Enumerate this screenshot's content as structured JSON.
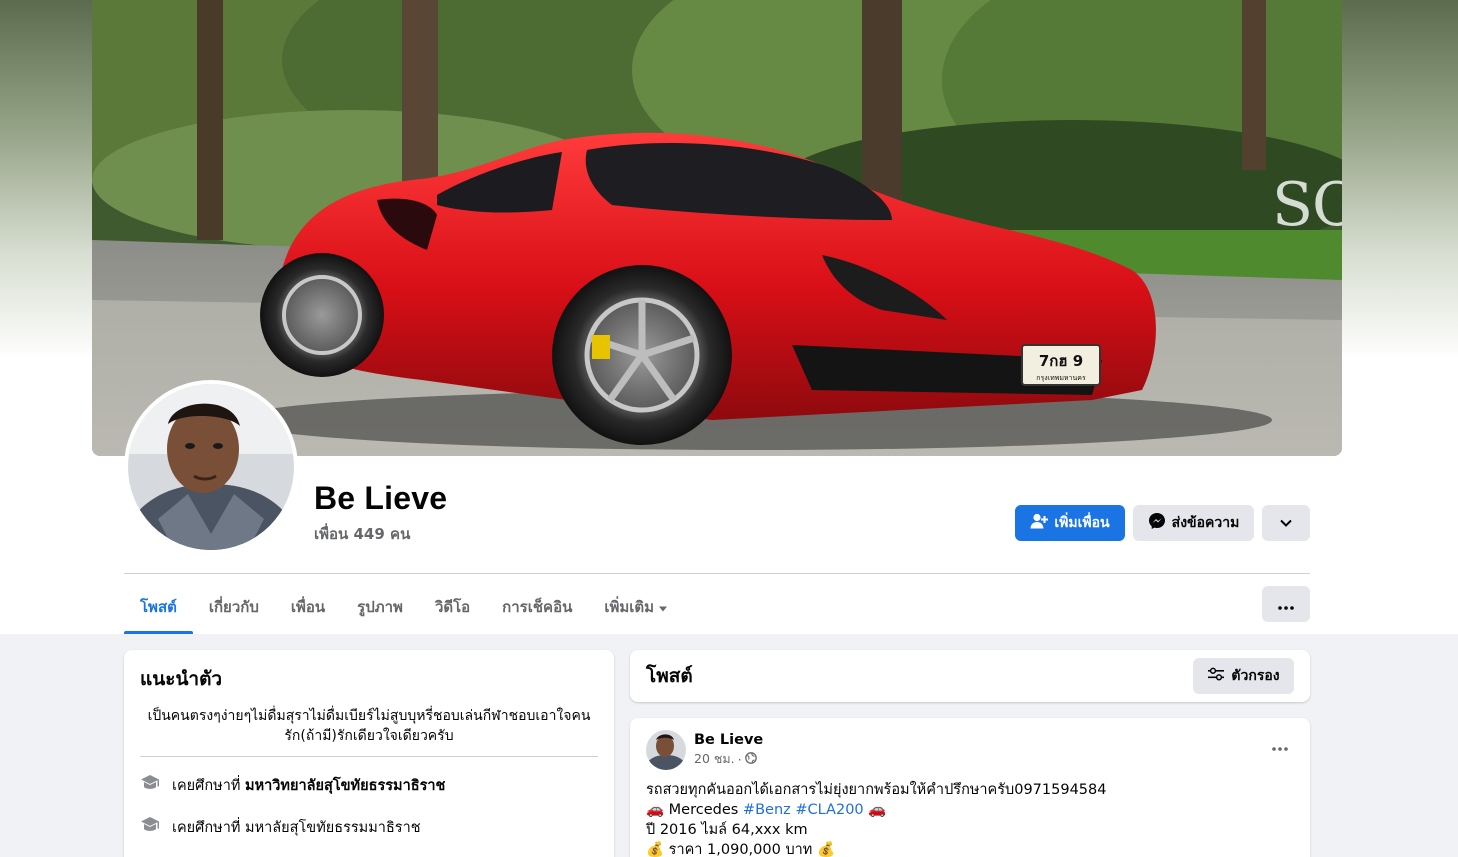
{
  "profile": {
    "name": "Be Lieve",
    "friends": "เพื่อน 449 คน"
  },
  "cover": {
    "plate_line1": "7กฮ  9",
    "plate_line2": "กรุงเทพมหานคร"
  },
  "actions": {
    "add_friend": "เพิ่มเพื่อน",
    "message": "ส่งข้อความ"
  },
  "tabs": [
    {
      "label": "โพสต์"
    },
    {
      "label": "เกี่ยวกับ"
    },
    {
      "label": "เพื่อน"
    },
    {
      "label": "รูปภาพ"
    },
    {
      "label": "วิดีโอ"
    },
    {
      "label": "การเช็คอิน"
    },
    {
      "label": "เพิ่มเติม"
    }
  ],
  "intro": {
    "title": "แนะนำตัว",
    "bio": "เป็นคนตรงๆง่ายๆไม่ดื่มสุราไม่ดื่มเบียร์ไม่สูบบุหรี่ชอบเล่นกีฬาชอบเอาใจคนรัก(ถ้ามี)รักเดียวใจเดียวครับ",
    "education": [
      {
        "prefix": "เคยศึกษาที่",
        "school": "มหาวิทยาลัยสุโขทัยธรรมาธิราช",
        "bold": true
      },
      {
        "prefix": "เคยศึกษาที่",
        "school": "มหาลัยสุโขทัยธรรมมาธิราช",
        "bold": false
      }
    ]
  },
  "posts_header": {
    "title": "โพสต์",
    "filter": "ตัวกรอง"
  },
  "post": {
    "author": "Be Lieve",
    "time": "20 ชม.",
    "separator": "·",
    "line1": "รถสวยทุกคันออกได้เอกสารไม่ยุ่งยากพร้อมให้คำปรึกษาครับ0971594584",
    "line2_prefix": "🚗 Mercedes ",
    "line2_tag1": "#Benz",
    "line2_space": " ",
    "line2_tag2": "#CLA200",
    "line2_suffix": " 🚗",
    "line3": "ปี 2016 ไมล์ 64,xxx km",
    "line4": "💰 ราคา 1,090,000 บาท 💰"
  },
  "colors": {
    "accent": "#1b74e4",
    "car": "#e0141c",
    "hashtag": "#216fdb"
  }
}
